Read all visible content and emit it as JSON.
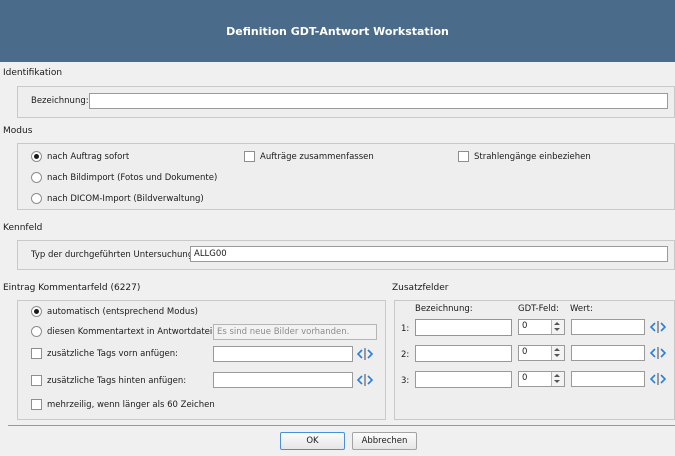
{
  "window": {
    "title": "Definition GDT-Antwort Workstation"
  },
  "identifikation": {
    "header": "Identifikation",
    "bezeichnung_label": "Bezeichnung:",
    "bezeichnung_value": ""
  },
  "modus": {
    "header": "Modus",
    "radios": [
      {
        "label": "nach Auftrag sofort",
        "checked": true
      },
      {
        "label": "nach Bildimport (Fotos und Dokumente)",
        "checked": false
      },
      {
        "label": "nach DICOM-Import (Bildverwaltung)",
        "checked": false
      }
    ],
    "checkbox_auftraege": "Aufträge zusammenfassen",
    "checkbox_strahlengaenge": "Strahlengänge einbeziehen"
  },
  "kennfeld": {
    "header": "Kennfeld",
    "typ_label": "Typ der durchgeführten Untersuchung:",
    "typ_value": "ALLG00"
  },
  "eintrag": {
    "header": "Eintrag Kommentarfeld (6227)",
    "radio_auto": "automatisch (entsprechend Modus)",
    "radio_text": "diesen Kommentartext in Antwortdatei:",
    "kommentar_placeholder": "Es sind neue Bilder vorhanden.",
    "tags_vorn": "zusätzliche Tags vorn anfügen:",
    "tags_hinten": "zusätzliche Tags hinten anfügen:",
    "mehrzeilig": "mehrzeilig, wenn länger als 60 Zeichen"
  },
  "zusatzfelder": {
    "header": "Zusatzfelder",
    "col_bezeichnung": "Bezeichnung:",
    "col_gdt": "GDT-Feld:",
    "col_wert": "Wert:",
    "rows": [
      {
        "num": "1:",
        "gdt": "0"
      },
      {
        "num": "2:",
        "gdt": "0"
      },
      {
        "num": "3:",
        "gdt": "0"
      }
    ]
  },
  "buttons": {
    "ok": "OK",
    "cancel": "Abbrechen"
  },
  "colors": {
    "titlebar": "#4a6b8a",
    "dialog_bg": "#f0f0f0",
    "focus_border": "#6f9ad6",
    "tag_icon": "#2a7de1"
  }
}
